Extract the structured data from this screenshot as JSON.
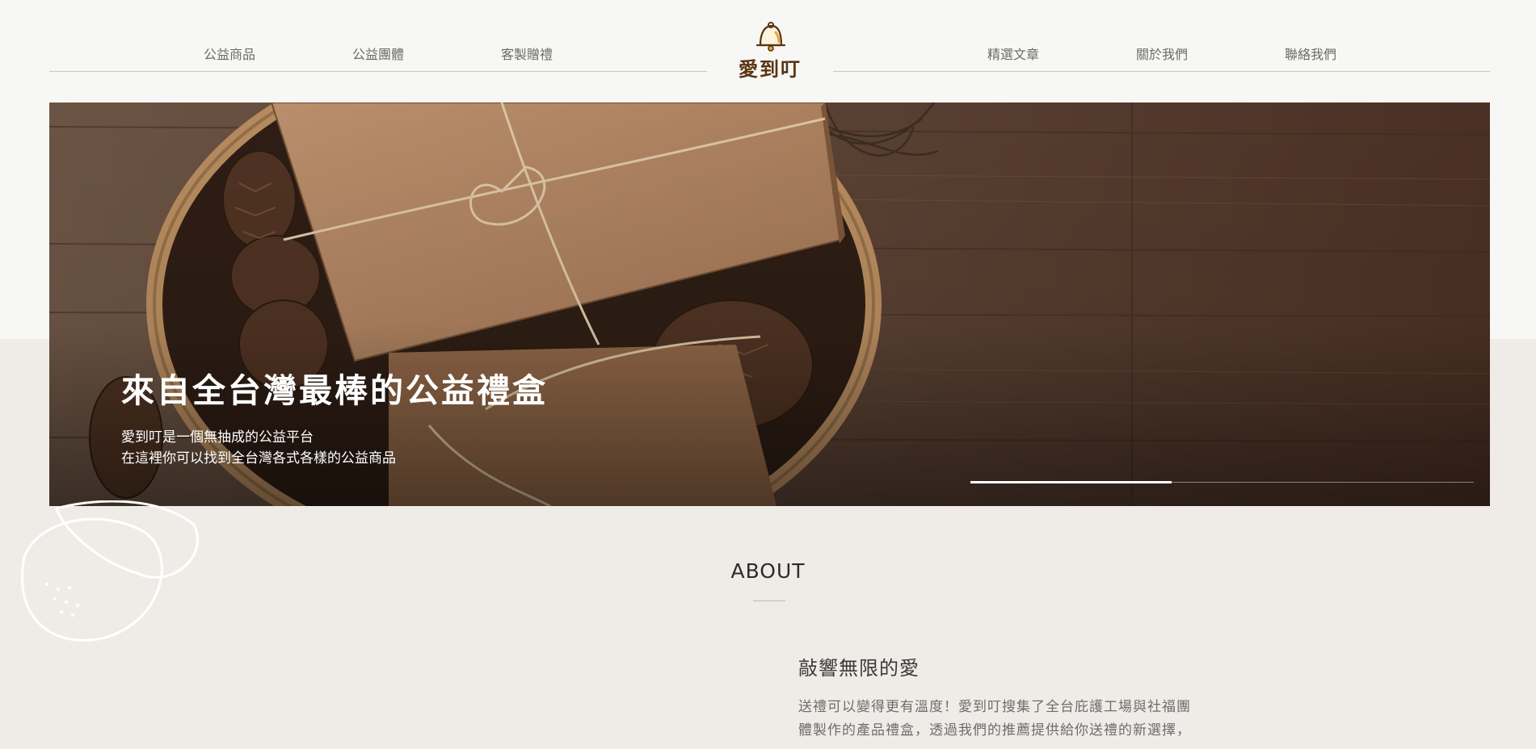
{
  "nav": {
    "left": [
      "公益商品",
      "公益團體",
      "客製贈禮"
    ],
    "right": [
      "精選文章",
      "關於我們",
      "聯絡我們"
    ]
  },
  "logo": {
    "text": "愛到叮",
    "icon": "bell-icon"
  },
  "hero": {
    "title": "來自全台灣最棒的公益禮盒",
    "subtitle_line1": "愛到叮是一個無抽成的公益平台",
    "subtitle_line2": "在這裡你可以找到全台灣各式各樣的公益商品",
    "slide_progress": 0.4
  },
  "about": {
    "title": "ABOUT",
    "heading": "敲響無限的愛",
    "body_lines": [
      "送禮可以變得更有溫度！愛到叮搜集了全台庇護工場與社福團",
      "體製作的產品禮盒，透過我們的推薦提供給你送禮的新選擇，"
    ]
  },
  "colors": {
    "brand": "#5a3414",
    "page_bg": "#f7f7f5",
    "section_bg": "#efece8"
  }
}
